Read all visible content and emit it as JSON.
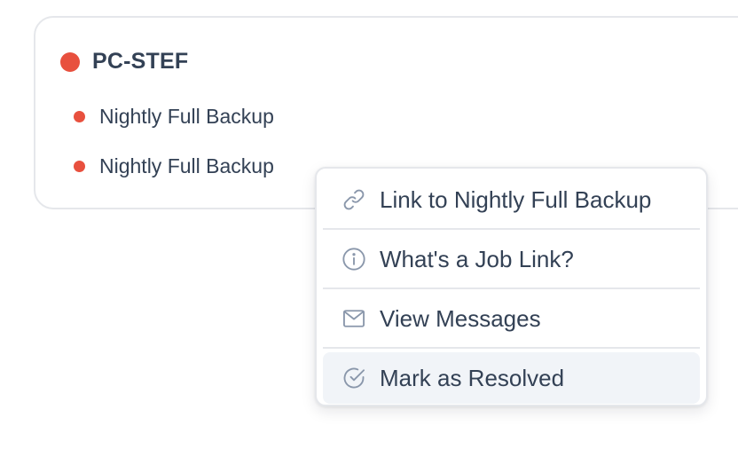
{
  "colors": {
    "status_error": "#e8503e",
    "icon_gray": "#8a97ab",
    "text": "#334155",
    "hover_bg": "#f1f4f8"
  },
  "device": {
    "name": "PC-STEF",
    "status": "error",
    "jobs": [
      {
        "label": "Nightly Full Backup",
        "status": "error"
      },
      {
        "label": "Nightly Full Backup",
        "status": "error"
      }
    ]
  },
  "context_menu": {
    "items": [
      {
        "label": "Link to Nightly Full Backup",
        "icon": "link-icon"
      },
      {
        "label": "What's a Job Link?",
        "icon": "info-icon"
      },
      {
        "label": "View Messages",
        "icon": "envelope-icon"
      },
      {
        "label": "Mark as Resolved",
        "icon": "check-circle-icon",
        "hovered": true
      }
    ]
  }
}
